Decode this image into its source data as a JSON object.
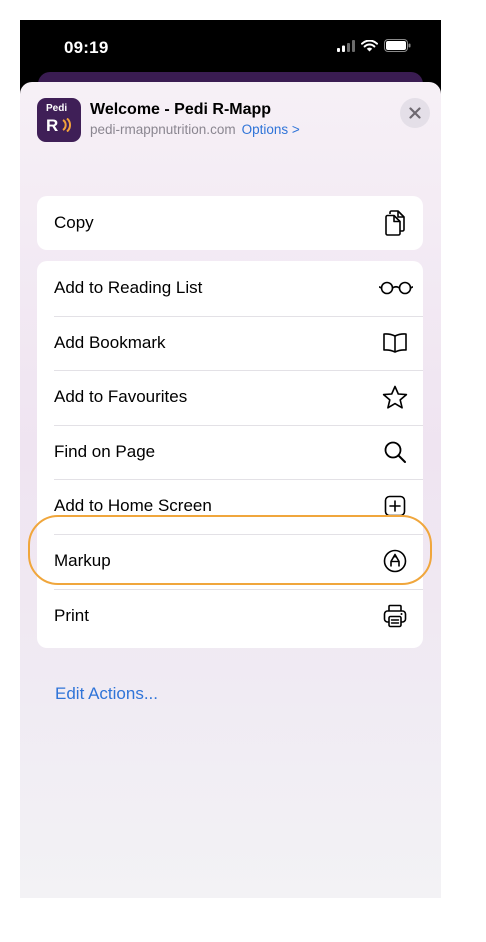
{
  "status_bar": {
    "time": "09:19"
  },
  "header": {
    "app_icon_line1": "Pedi",
    "app_icon_line2": "R",
    "title": "Welcome - Pedi R-Mapp",
    "domain": "pedi-rmappnutrition.com",
    "options_label": "Options >"
  },
  "group1": [
    {
      "label": "Copy",
      "icon": "copy-icon"
    }
  ],
  "group2": [
    {
      "label": "Add to Reading List",
      "icon": "glasses-icon"
    },
    {
      "label": "Add Bookmark",
      "icon": "book-icon"
    },
    {
      "label": "Add to Favourites",
      "icon": "star-icon"
    },
    {
      "label": "Find on Page",
      "icon": "search-icon"
    },
    {
      "label": "Add to Home Screen",
      "icon": "plus-square-icon"
    },
    {
      "label": "Markup",
      "icon": "markup-icon"
    },
    {
      "label": "Print",
      "icon": "printer-icon"
    }
  ],
  "edit_actions_label": "Edit Actions...",
  "colors": {
    "accent_blue": "#2f74d8",
    "highlight_orange": "#f0a63c",
    "app_icon_purple": "#3f1f57"
  }
}
